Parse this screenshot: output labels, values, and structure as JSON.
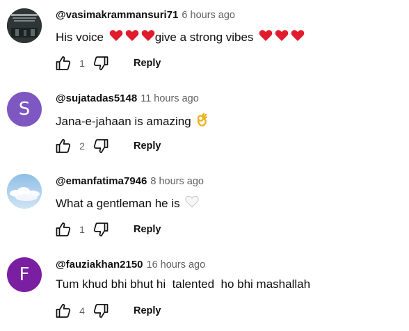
{
  "comments": [
    {
      "handle": "@vasimakrammansuri71",
      "time": "6 hours ago",
      "text_parts": [
        "His voice ",
        "give a strong vibes "
      ],
      "likes": "1",
      "reply_label": "Reply",
      "avatar": {
        "type": "image",
        "bg": "#2e3534"
      }
    },
    {
      "handle": "@sujatadas5148",
      "time": "11 hours ago",
      "text": "Jana-e-jahaan is amazing ",
      "likes": "2",
      "reply_label": "Reply",
      "avatar": {
        "type": "letter",
        "letter": "S",
        "bg": "#7e57c2"
      }
    },
    {
      "handle": "@emanfatima7946",
      "time": "8 hours ago",
      "text": "What a gentleman he is ",
      "likes": "1",
      "reply_label": "Reply",
      "avatar": {
        "type": "image",
        "bg": "#a9cdea"
      }
    },
    {
      "handle": "@fauziakhan2150",
      "time": "16 hours ago",
      "text": "Tum khud bhi bhut hi  talented  ho bhi mashallah",
      "likes": "4",
      "reply_label": "Reply",
      "avatar": {
        "type": "letter",
        "letter": "F",
        "bg": "#7b1fa2"
      }
    }
  ],
  "colors": {
    "heart": "#e11d2d",
    "secondary_text": "#606060",
    "primary_text": "#0f0f0f"
  },
  "icons": {
    "like": "thumb-up-icon",
    "dislike": "thumb-down-icon",
    "heart": "red-heart-emoji-icon",
    "ok_hand": "ok-hand-emoji-icon",
    "white_heart": "white-heart-emoji-icon"
  }
}
